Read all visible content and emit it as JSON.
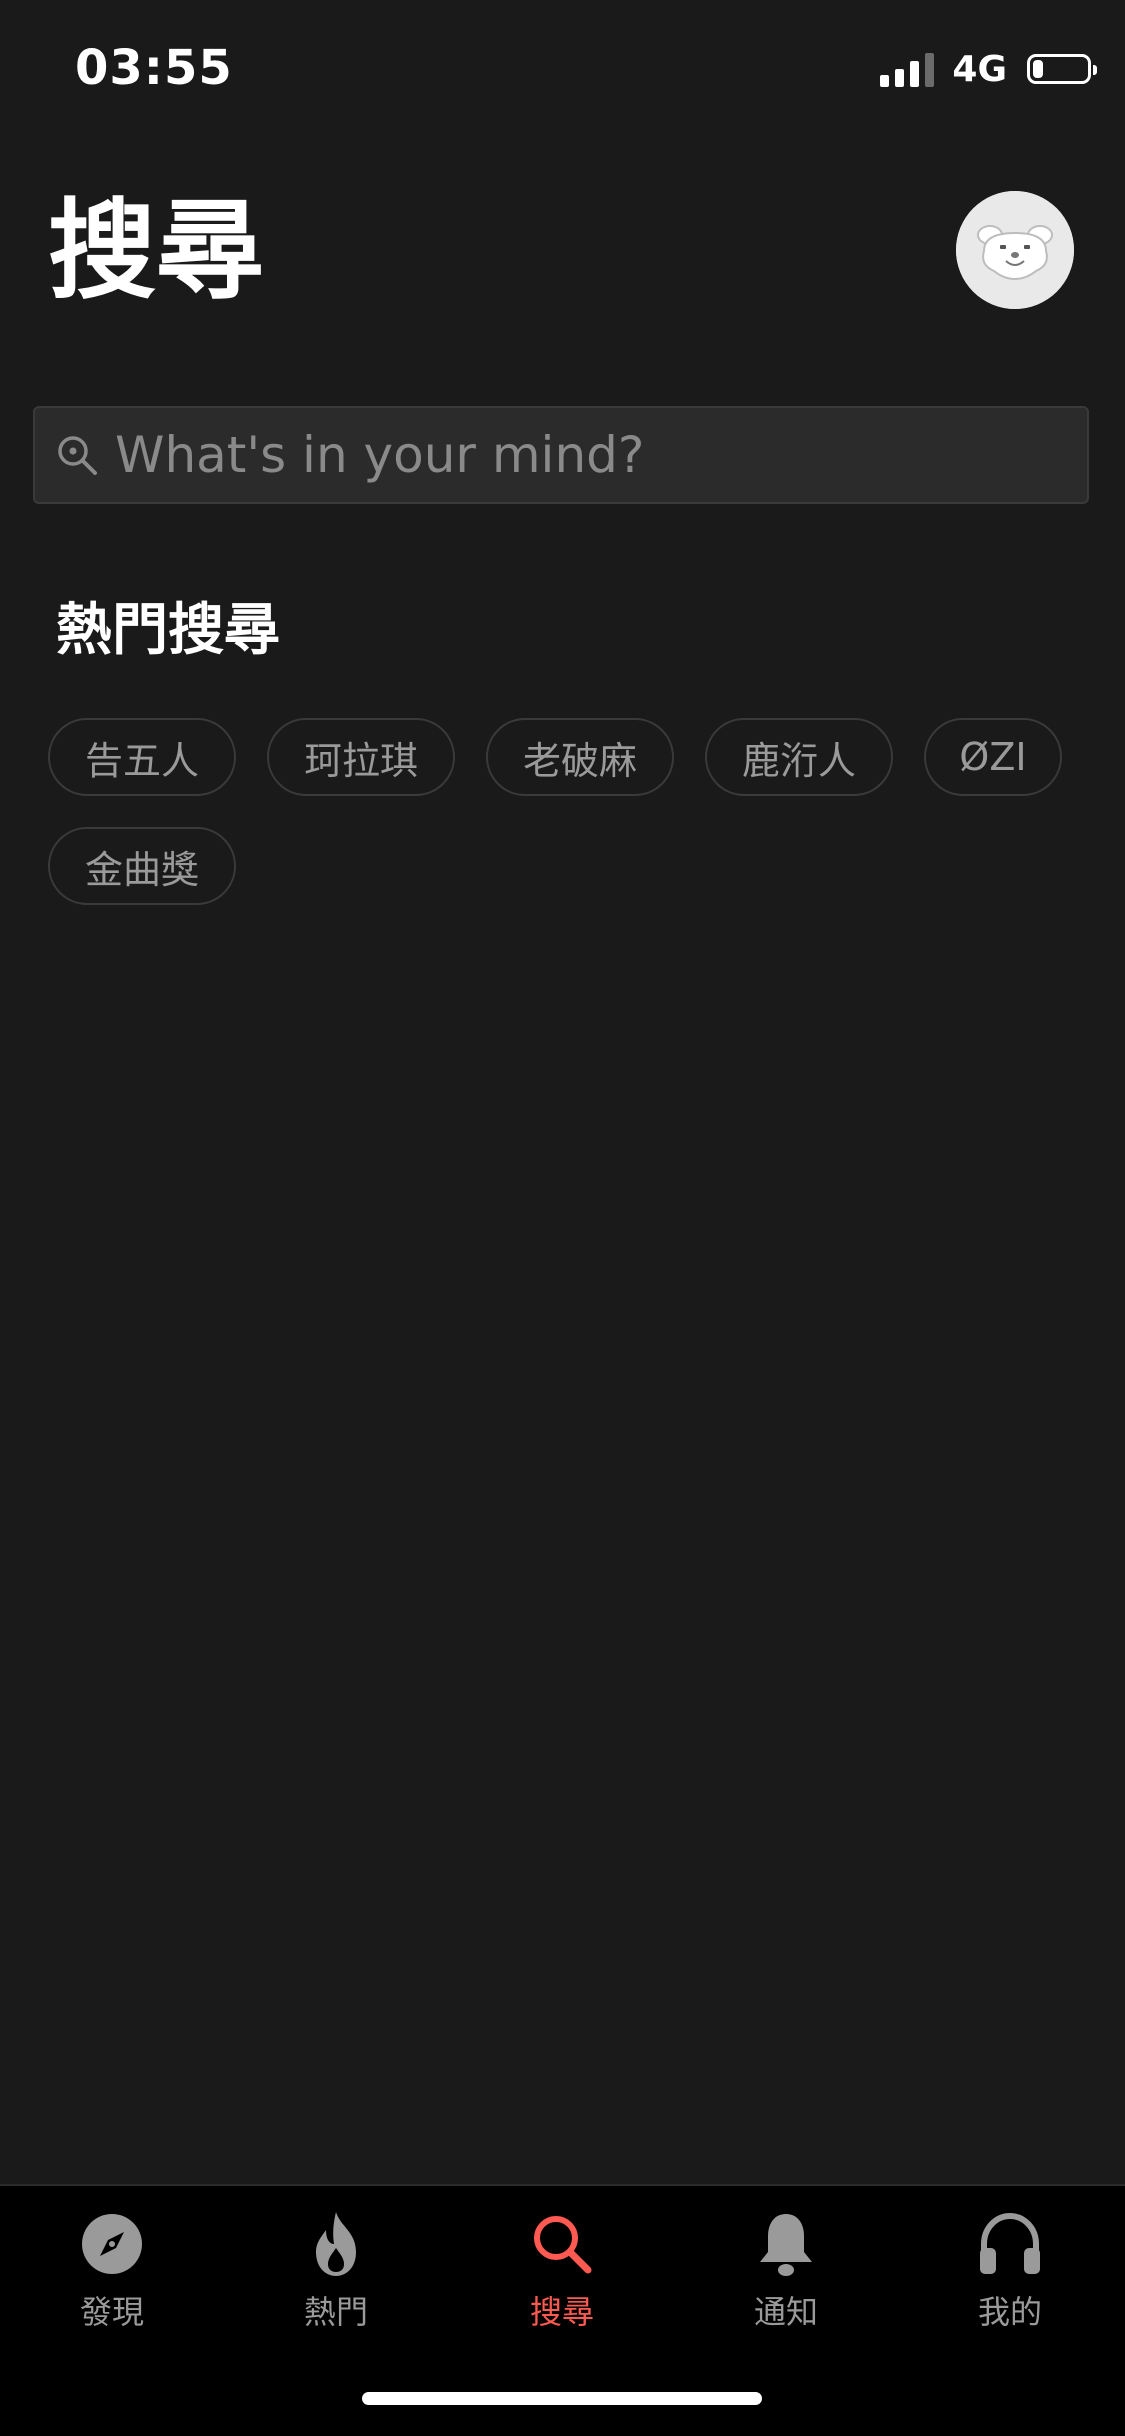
{
  "status_bar": {
    "time": "03:55",
    "network": "4G",
    "signal_bars": 3,
    "signal_bars_total": 4,
    "battery_level": 0.2
  },
  "header": {
    "title": "搜尋",
    "avatar_icon": "cartoon-avatar-icon"
  },
  "search": {
    "placeholder": "What's in your mind?",
    "value": "",
    "icon": "search-icon"
  },
  "trending": {
    "title": "熱門搜尋",
    "items": [
      {
        "label": "告五人"
      },
      {
        "label": "珂拉琪"
      },
      {
        "label": "老破麻"
      },
      {
        "label": "鹿洐人"
      },
      {
        "label": "ØZI"
      },
      {
        "label": "金曲獎"
      }
    ]
  },
  "tab_bar": {
    "active_color": "#ff5a52",
    "inactive_color": "#9a9a9a",
    "items": [
      {
        "label": "發現",
        "icon": "compass-icon",
        "active": false
      },
      {
        "label": "熱門",
        "icon": "flame-icon",
        "active": false
      },
      {
        "label": "搜尋",
        "icon": "search-icon",
        "active": true
      },
      {
        "label": "通知",
        "icon": "bell-icon",
        "active": false
      },
      {
        "label": "我的",
        "icon": "headphones-icon",
        "active": false
      }
    ]
  }
}
